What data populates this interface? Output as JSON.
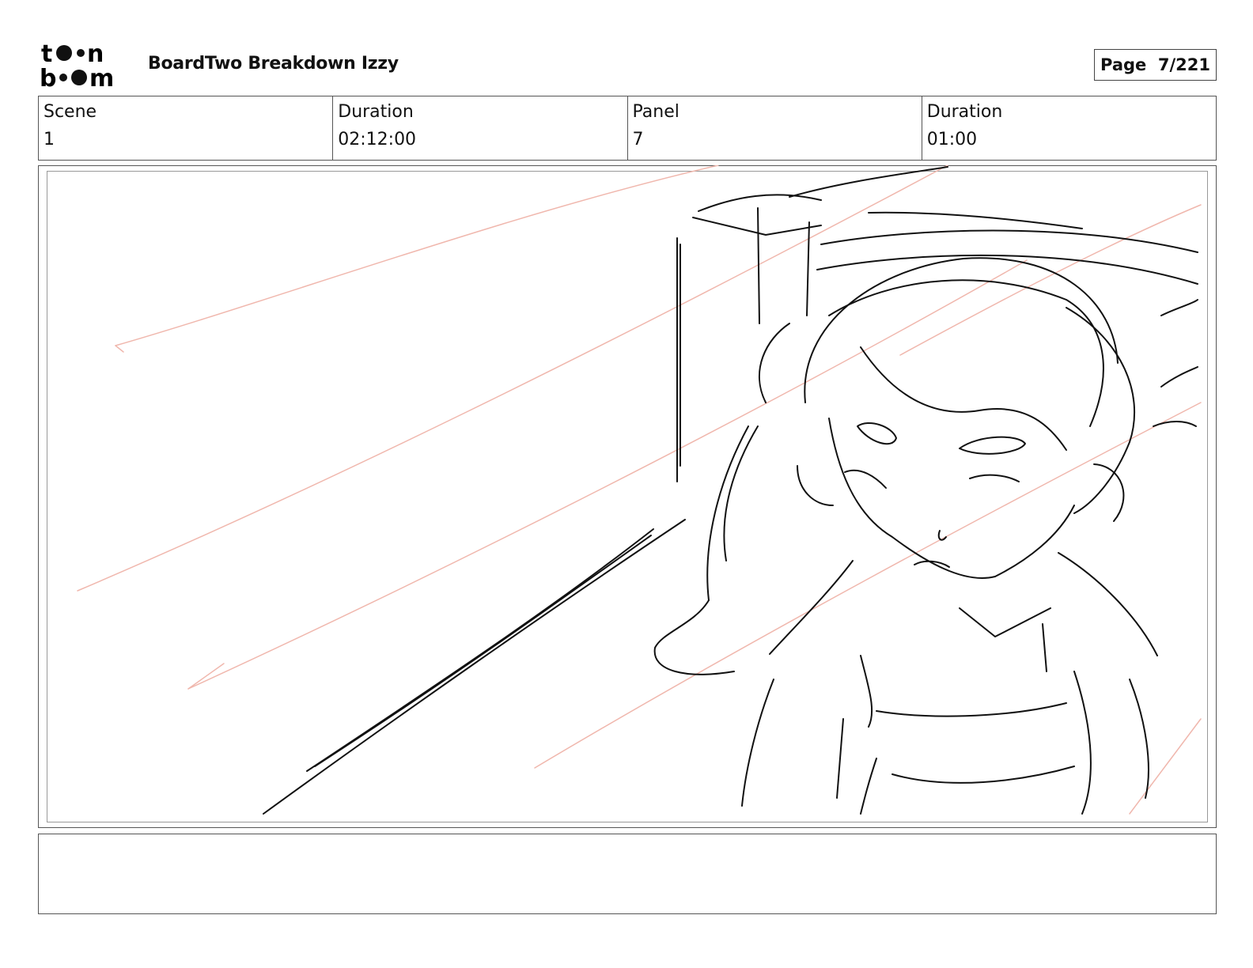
{
  "header": {
    "logo": {
      "text_top": "toon",
      "text_bottom": "boom",
      "icon": "toonboom-logo"
    },
    "title": "BoardTwo Breakdown Izzy",
    "page_label": "Page",
    "page_value": "7/221"
  },
  "meta": {
    "scene_label": "Scene",
    "scene_value": "1",
    "scene_duration_label": "Duration",
    "scene_duration_value": "02:12:00",
    "panel_label": "Panel",
    "panel_value": "7",
    "panel_duration_label": "Duration",
    "panel_duration_value": "01:00"
  },
  "panel": {
    "image": "storyboard-sketch",
    "line_color": "#111111",
    "guide_color": "#f0b7ad"
  },
  "caption": {
    "text": ""
  }
}
